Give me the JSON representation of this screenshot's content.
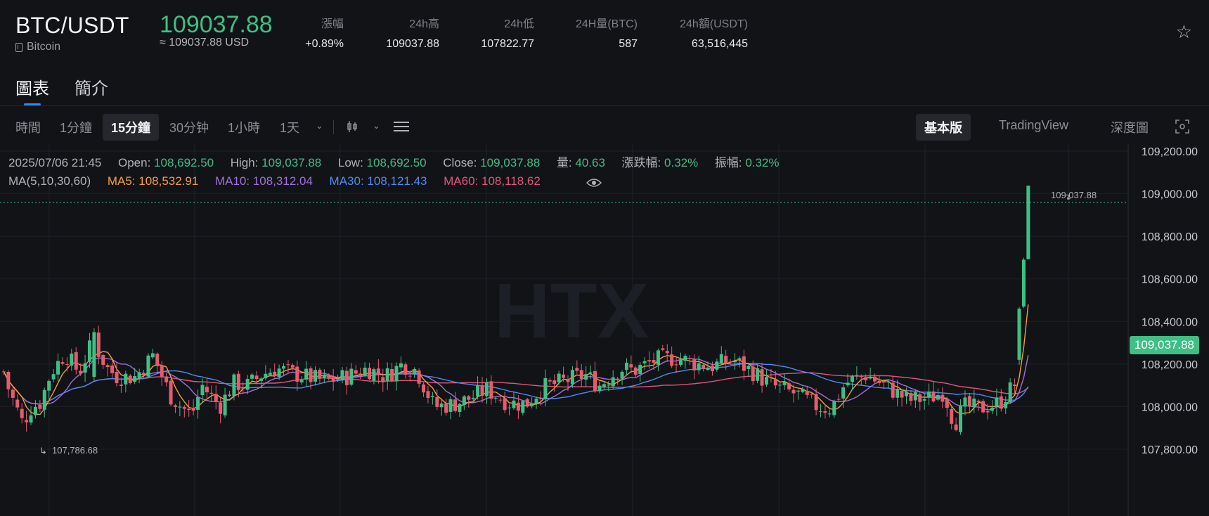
{
  "header": {
    "pair": "BTC/USDT",
    "coin_name": "Bitcoin",
    "price": "109037.88",
    "price_usd": "≈ 109037.88 USD",
    "stats": [
      {
        "label": "漲幅",
        "value": "+0.89%"
      },
      {
        "label": "24h高",
        "value": "109037.88"
      },
      {
        "label": "24h低",
        "value": "107822.77"
      },
      {
        "label": "24H量(BTC)",
        "value": "587"
      },
      {
        "label": "24h額(USDT)",
        "value": "63,516,445"
      }
    ]
  },
  "tabs": [
    "圖表",
    "簡介"
  ],
  "toolbar": {
    "intervals": [
      "時間",
      "1分鐘",
      "15分鐘",
      "30分钟",
      "1小時",
      "1天"
    ],
    "selected": "15分鐘",
    "right": [
      "基本版",
      "TradingView",
      "深度圖"
    ]
  },
  "candle_info": {
    "time": "2025/07/06 21:45",
    "open_label": "Open:",
    "open": "108,692.50",
    "high_label": "High:",
    "high": "109,037.88",
    "low_label": "Low:",
    "low": "108,692.50",
    "close_label": "Close:",
    "close": "109,037.88",
    "vol_label": "量:",
    "vol": "40.63",
    "chg_label": "漲跌幅:",
    "chg": "0.32%",
    "amp_label": "振幅:",
    "amp": "0.32%"
  },
  "ma": {
    "title": "MA(5,10,30,60)",
    "ma5_label": "MA5:",
    "ma5": "108,532.91",
    "ma10_label": "MA10:",
    "ma10": "108,312.04",
    "ma30_label": "MA30:",
    "ma30": "108,121.43",
    "ma60_label": "MA60:",
    "ma60": "108,118.62"
  },
  "watermark": "HTX",
  "price_tag": "109,037.88",
  "chart_data": {
    "type": "candlestick",
    "y_ticks": [
      "109,200.00",
      "109,000.00",
      "108,800.00",
      "108,600.00",
      "108,400.00",
      "108,200.00",
      "108,000.00",
      "107,800.00"
    ],
    "ylim": [
      107700,
      109270
    ],
    "last_price": 109037.88,
    "max_label": "109,037.88",
    "min_label": "107,786.68",
    "colors": {
      "up": "#3fbf84",
      "down": "#e55c6e",
      "ma5": "#f59e3b",
      "ma10": "#a070d8",
      "ma30": "#4d8cf0",
      "ma60": "#e0557a"
    }
  }
}
